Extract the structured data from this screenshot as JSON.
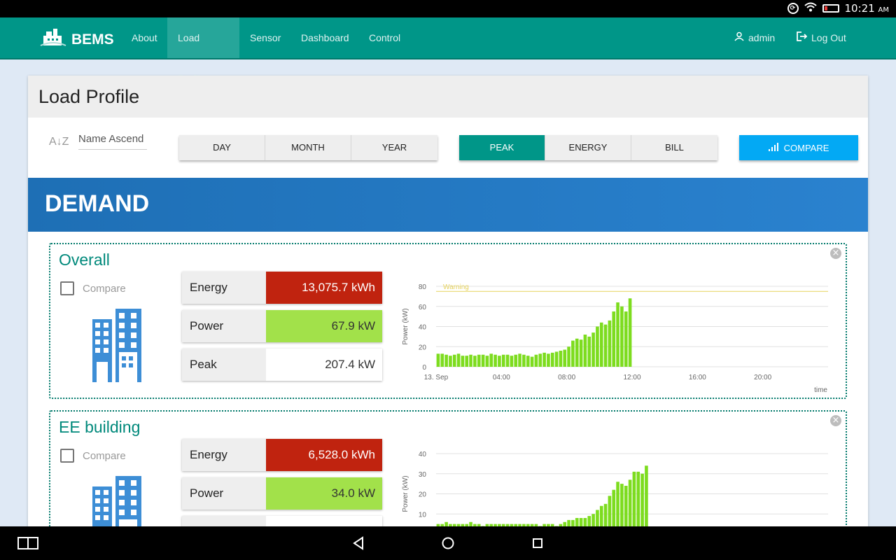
{
  "status_bar": {
    "time": "10:21",
    "ampm": "AM"
  },
  "nav": {
    "brand": "BEMS",
    "items": [
      {
        "label": "About",
        "active": false
      },
      {
        "label": "Load Profile",
        "active": true
      },
      {
        "label": "Sensor",
        "active": false
      },
      {
        "label": "Dashboard",
        "active": false
      },
      {
        "label": "Control",
        "active": false
      }
    ],
    "user": "admin",
    "logout": "Log Out"
  },
  "page": {
    "title": "Load Profile",
    "sort_icon": "A↓Z",
    "sort_label": "Name Ascend",
    "period_buttons": [
      "DAY",
      "MONTH",
      "YEAR"
    ],
    "metric_buttons": [
      "PEAK",
      "ENERGY",
      "BILL"
    ],
    "compare_button": "COMPARE",
    "section_title": "DEMAND",
    "compare_label": "Compare"
  },
  "colors": {
    "accent": "#009688",
    "energy": "#c0230f",
    "power": "#a2e14a",
    "compare": "#03a9f4",
    "bar": "#7ddc1f"
  },
  "panels": [
    {
      "title": "Overall",
      "energy_label": "Energy",
      "energy_value": "13,075.7 kWh",
      "power_label": "Power",
      "power_value": "67.9 kW",
      "peak_label": "Peak",
      "peak_value": "207.4 kW"
    },
    {
      "title": "EE building",
      "energy_label": "Energy",
      "energy_value": "6,528.0 kWh",
      "power_label": "Power",
      "power_value": "34.0 kW",
      "peak_label": "",
      "peak_value": ""
    }
  ],
  "chart_data": [
    {
      "type": "bar",
      "ylabel": "Power (kW)",
      "xlabel": "time",
      "ylim": [
        0,
        80
      ],
      "yticks": [
        0,
        20,
        40,
        60,
        80
      ],
      "xticks": [
        "13. Sep",
        "04:00",
        "08:00",
        "12:00",
        "16:00",
        "20:00"
      ],
      "warning_label": "Warning",
      "warning_value": 75,
      "grid": true,
      "x_range_hours": [
        0,
        24
      ],
      "interval_minutes": 15,
      "values": [
        13,
        13,
        12,
        11,
        12,
        13,
        11,
        11,
        12,
        11,
        12,
        12,
        11,
        13,
        12,
        11,
        12,
        12,
        11,
        12,
        13,
        12,
        11,
        10,
        12,
        13,
        14,
        13,
        14,
        15,
        16,
        17,
        20,
        26,
        28,
        27,
        32,
        30,
        34,
        40,
        44,
        42,
        46,
        55,
        64,
        60,
        55,
        68
      ]
    },
    {
      "type": "bar",
      "ylabel": "Power (kW)",
      "xlabel": "time",
      "ylim": [
        0,
        40
      ],
      "yticks": [
        0,
        10,
        20,
        30,
        40
      ],
      "xticks": [],
      "grid": true,
      "x_range_hours": [
        0,
        24
      ],
      "interval_minutes": 15,
      "values": [
        5,
        5,
        6,
        5,
        5,
        5,
        5,
        5,
        6,
        5,
        5,
        4,
        5,
        5,
        5,
        5,
        5,
        5,
        5,
        5,
        5,
        5,
        5,
        5,
        5,
        4,
        5,
        5,
        5,
        4,
        5,
        6,
        7,
        7,
        8,
        8,
        8,
        9,
        10,
        12,
        14,
        15,
        19,
        22,
        26,
        25,
        24,
        27,
        31,
        31,
        30,
        34
      ]
    }
  ]
}
